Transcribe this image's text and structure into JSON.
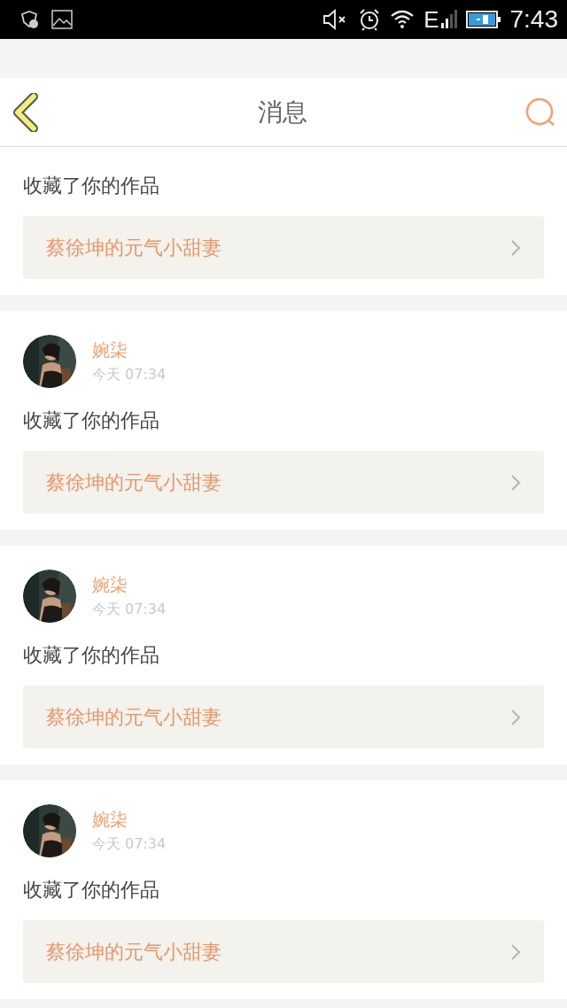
{
  "status_bar": {
    "network": "E",
    "time": "7:43"
  },
  "header": {
    "title": "消息"
  },
  "messages": [
    {
      "kind": "clipped",
      "action": "收藏了你的作品",
      "work": "蔡徐坤的元气小甜妻"
    },
    {
      "kind": "full",
      "user": "婉柒",
      "time": "今天 07:34",
      "action": "收藏了你的作品",
      "work": "蔡徐坤的元气小甜妻"
    },
    {
      "kind": "full",
      "user": "婉柒",
      "time": "今天 07:34",
      "action": "收藏了你的作品",
      "work": "蔡徐坤的元气小甜妻"
    },
    {
      "kind": "full",
      "user": "婉柒",
      "time": "今天 07:34",
      "action": "收藏了你的作品",
      "work": "蔡徐坤的元气小甜妻"
    }
  ]
}
